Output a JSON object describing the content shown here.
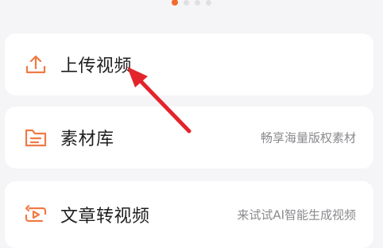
{
  "pager": {
    "dots": 4,
    "active_index": 0
  },
  "menu": {
    "items": [
      {
        "label": "上传视频",
        "subtitle": "",
        "icon": "upload-icon"
      },
      {
        "label": "素材库",
        "subtitle": "畅享海量版权素材",
        "icon": "folder-icon"
      },
      {
        "label": "文章转视频",
        "subtitle": "来试试AI智能生成视频",
        "icon": "article-video-icon"
      }
    ]
  },
  "colors": {
    "accent": "#f26a2e",
    "icon": "#f07a45",
    "annotation_arrow": "#e3242b",
    "card_background": "#ffffff",
    "page_background": "#f5f5f7"
  }
}
